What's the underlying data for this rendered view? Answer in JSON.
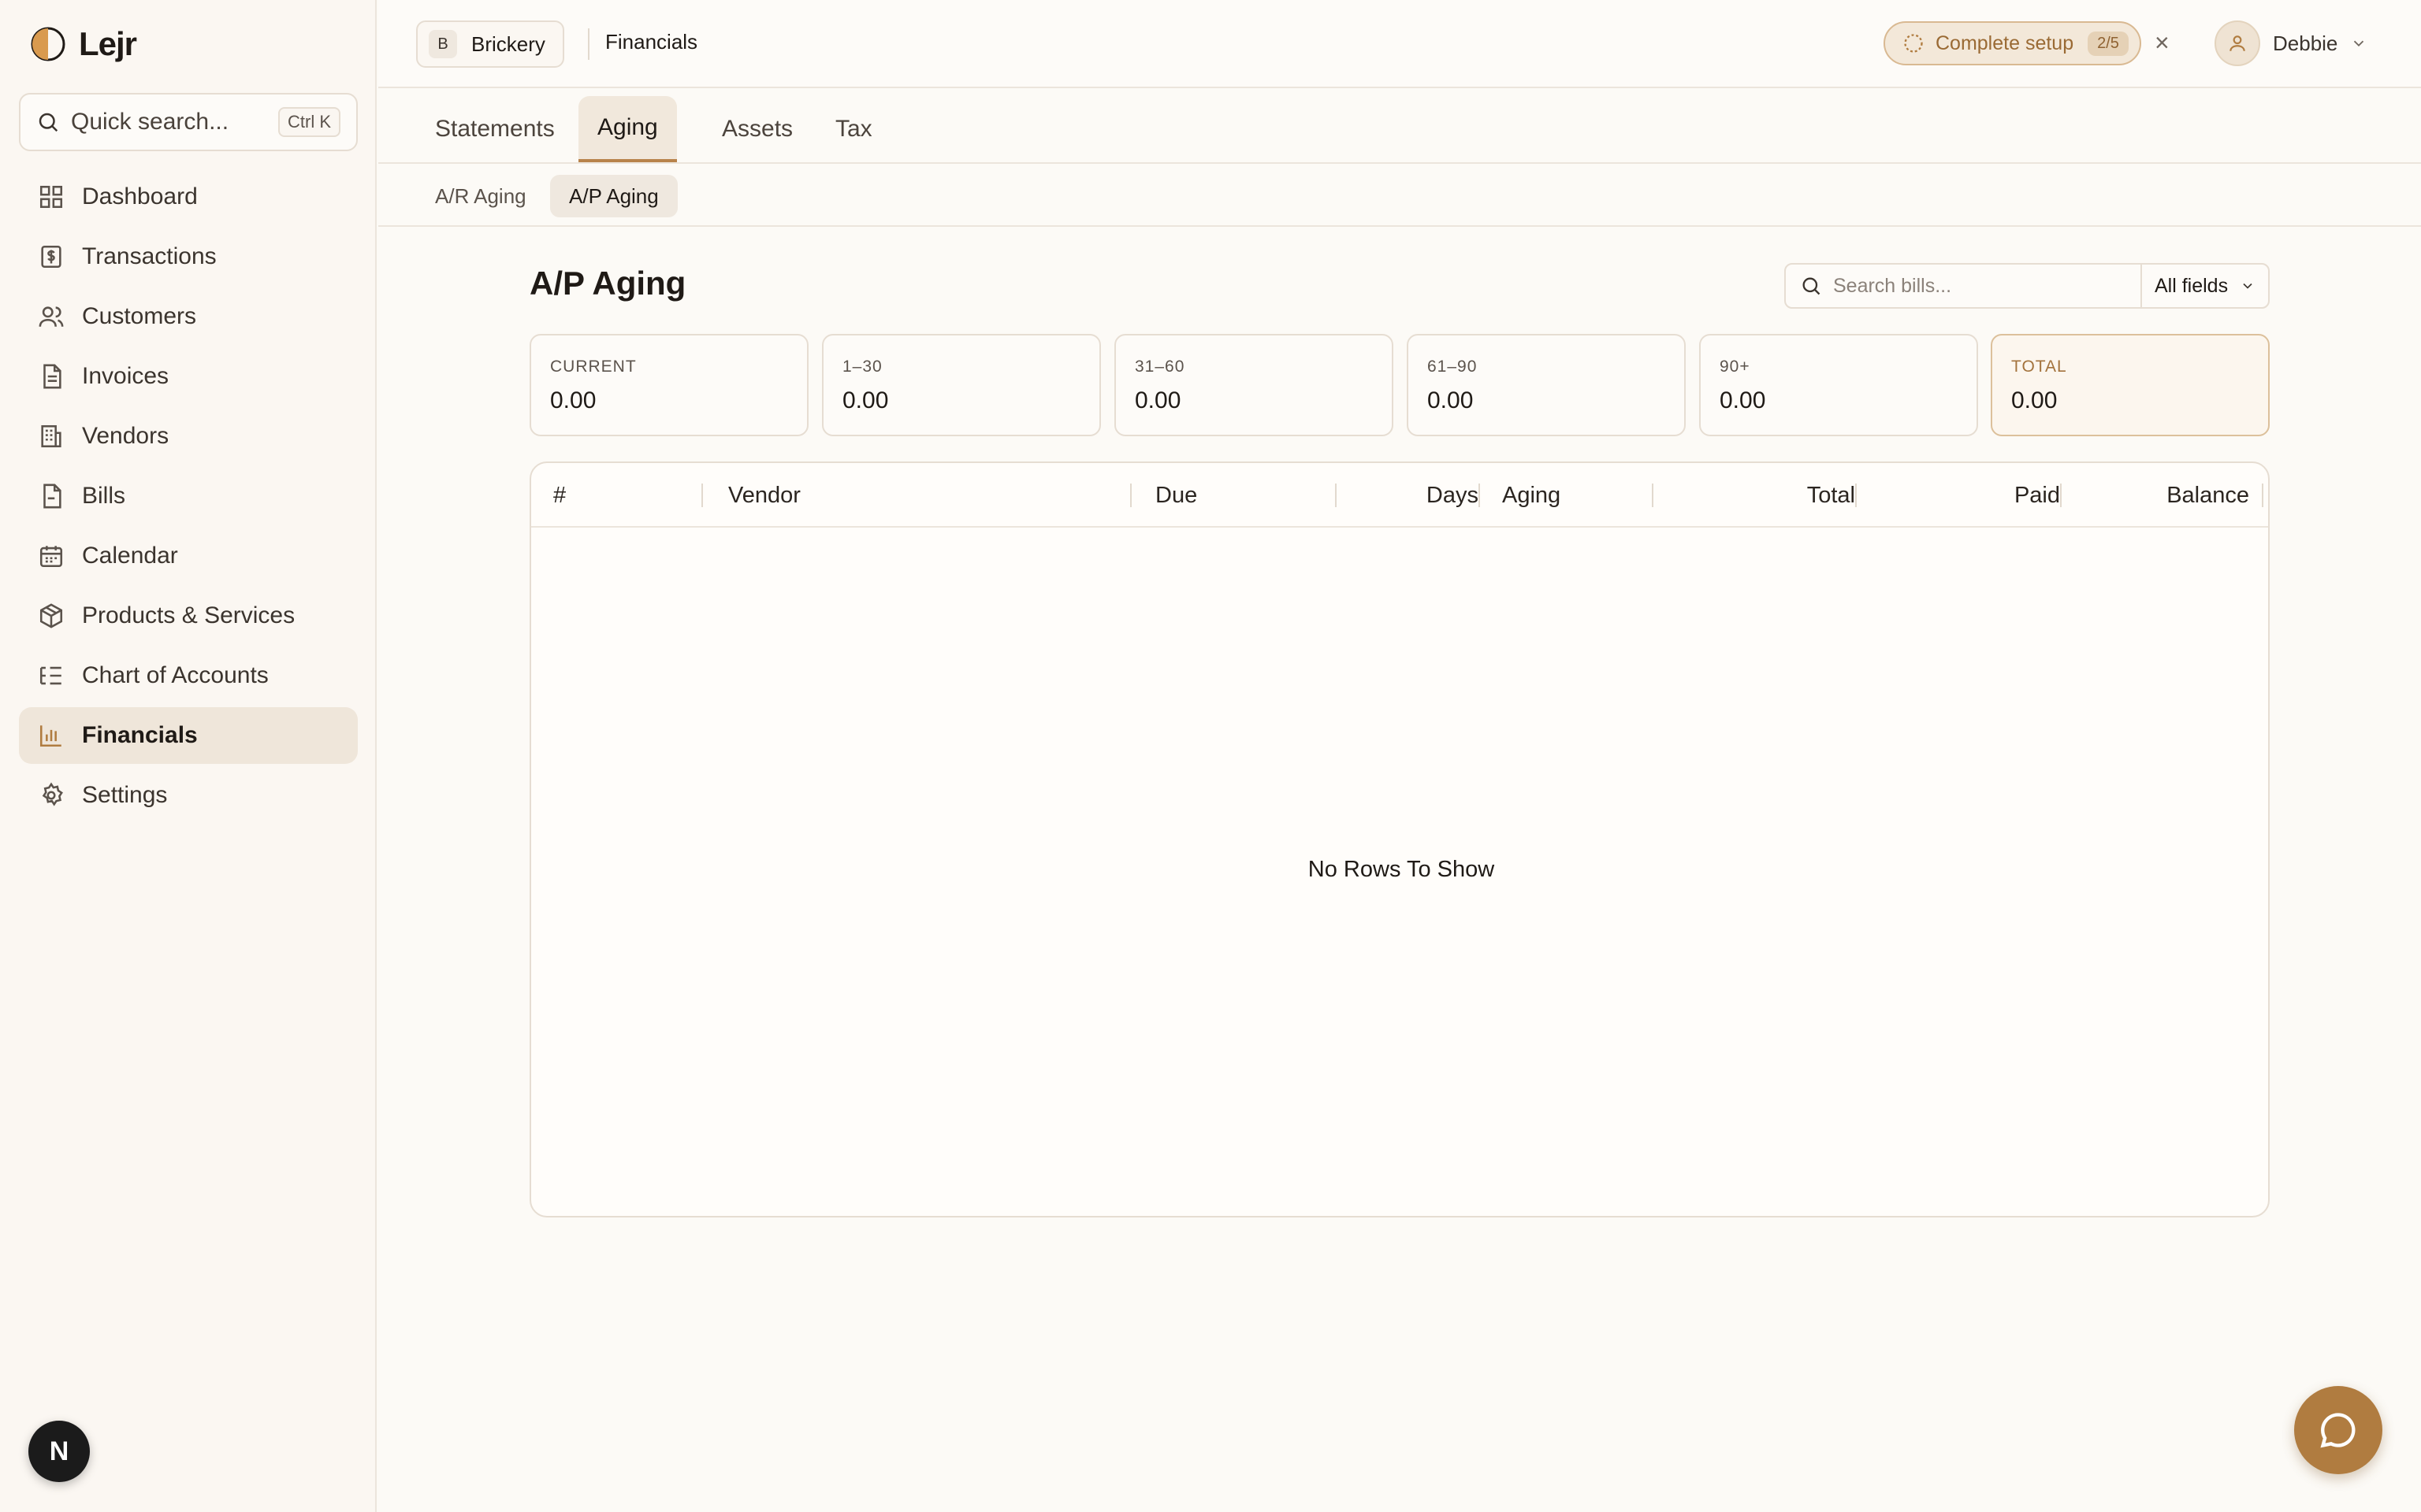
{
  "app": {
    "name": "Lejr"
  },
  "search": {
    "placeholder": "Quick search...",
    "shortcut": "Ctrl K"
  },
  "sidebar": {
    "items": [
      {
        "label": "Dashboard",
        "icon": "dashboard-icon"
      },
      {
        "label": "Transactions",
        "icon": "dollar-doc-icon"
      },
      {
        "label": "Customers",
        "icon": "users-icon"
      },
      {
        "label": "Invoices",
        "icon": "invoice-icon"
      },
      {
        "label": "Vendors",
        "icon": "building-icon"
      },
      {
        "label": "Bills",
        "icon": "bill-icon"
      },
      {
        "label": "Calendar",
        "icon": "calendar-icon"
      },
      {
        "label": "Products & Services",
        "icon": "box-icon"
      },
      {
        "label": "Chart of Accounts",
        "icon": "list-tree-icon"
      },
      {
        "label": "Financials",
        "icon": "bar-chart-icon",
        "active": true
      },
      {
        "label": "Settings",
        "icon": "gear-icon"
      }
    ]
  },
  "bottom_avatar": {
    "letter": "N"
  },
  "topbar": {
    "org_initial": "B",
    "org_name": "Brickery",
    "breadcrumb": "Financials",
    "setup_label": "Complete setup",
    "setup_progress": "2/5",
    "close": "×",
    "user_name": "Debbie"
  },
  "tabs": [
    "Statements",
    "Aging",
    "Assets",
    "Tax"
  ],
  "active_tab": "Aging",
  "subtabs": [
    "A/R Aging",
    "A/P Aging"
  ],
  "active_subtab": "A/P Aging",
  "page": {
    "title": "A/P Aging",
    "search_placeholder": "Search bills...",
    "field_filter": "All fields"
  },
  "summary_cards": [
    {
      "label": "CURRENT",
      "value": "0.00"
    },
    {
      "label": "1–30",
      "value": "0.00"
    },
    {
      "label": "31–60",
      "value": "0.00"
    },
    {
      "label": "61–90",
      "value": "0.00"
    },
    {
      "label": "90+",
      "value": "0.00"
    },
    {
      "label": "TOTAL",
      "value": "0.00"
    }
  ],
  "table": {
    "columns": [
      "#",
      "Vendor",
      "Due",
      "Days",
      "Aging",
      "Total",
      "Paid",
      "Balance"
    ],
    "rows": [],
    "empty_message": "No Rows To Show"
  },
  "colors": {
    "accent": "#b07c40",
    "active_bg": "#efe6da",
    "background": "#fcfaf6"
  }
}
